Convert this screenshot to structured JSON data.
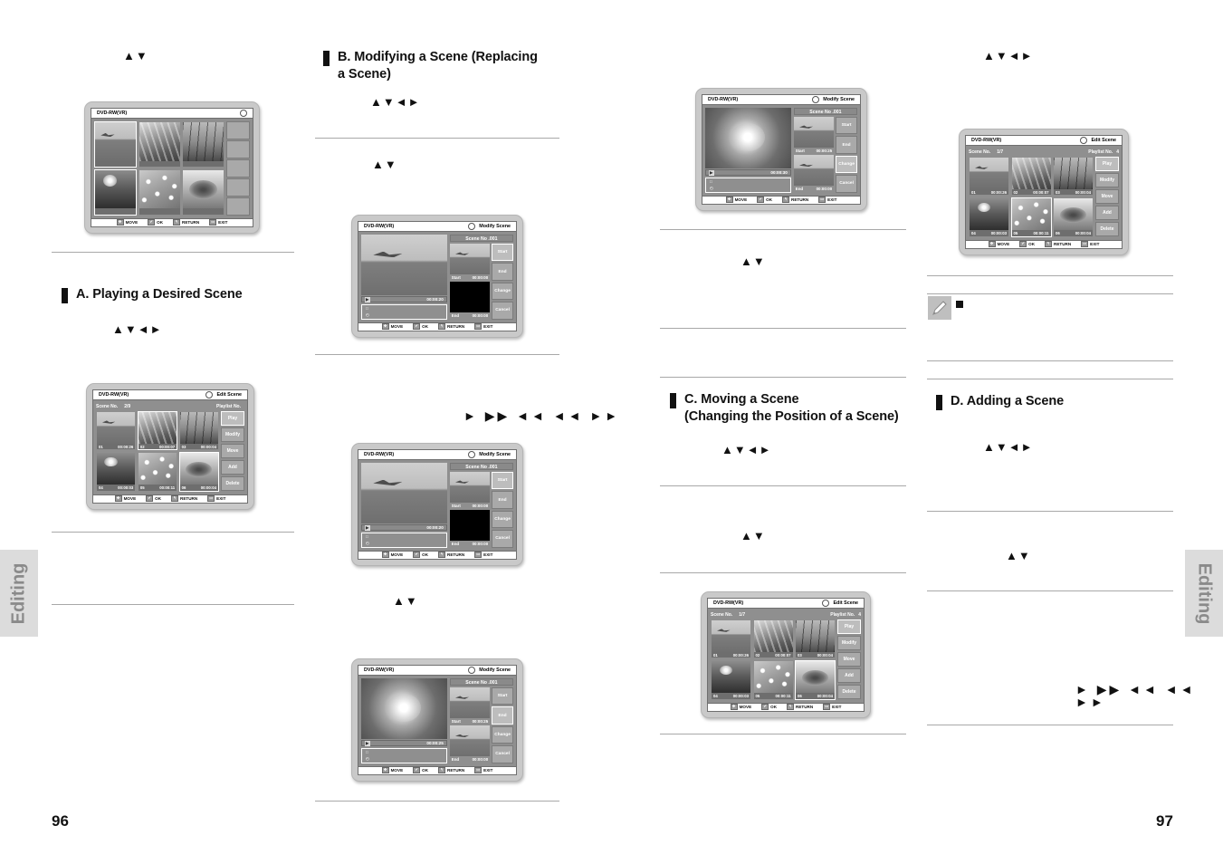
{
  "doc": {
    "left_page_number": "96",
    "right_page_number": "97",
    "left_tab_label": "Editing",
    "right_tab_label": "Editing"
  },
  "glyphs": {
    "ud": "▲▼",
    "udlr": "▲▼◄►",
    "transport": "► ▶▶ ◄◄ ◄◄ ►►",
    "note_bullet": "■"
  },
  "headings": {
    "a": "A. Playing a Desired Scene",
    "b": "B. Modifying a Scene (Replacing\na Scene)",
    "c": "C. Moving a Scene\n(Changing the Position of a Scene)",
    "d": "D. Adding a Scene"
  },
  "osd_common": {
    "disc_label": "DVD-RW(VR)",
    "footer": [
      {
        "key": "✥",
        "label": "MOVE"
      },
      {
        "key": "✔",
        "label": "OK"
      },
      {
        "key": "↰",
        "label": "RETURN"
      },
      {
        "key": "▭",
        "label": "EXIT"
      }
    ],
    "edit_buttons": [
      "Play",
      "Modify",
      "Move",
      "Add",
      "Delete"
    ],
    "modify_buttons": [
      "Start",
      "End",
      "Change",
      "Cancel"
    ],
    "scene_no_label": "Scene No.",
    "playlist_no_label": "Playlist No.",
    "start_label": "Start",
    "end_label": "End"
  },
  "screens": {
    "index_1": {
      "title": "",
      "cells": [
        {
          "id": "",
          "time": "",
          "photo": "ph-sky",
          "selected": true
        },
        {
          "id": "",
          "time": "",
          "photo": "ph-grass",
          "selected": false
        },
        {
          "id": "",
          "time": "",
          "photo": "ph-stems",
          "selected": false
        },
        {
          "id": "",
          "time": "",
          "photo": "ph-water",
          "selected": true
        },
        {
          "id": "",
          "time": "",
          "photo": "ph-speck",
          "selected": false
        },
        {
          "id": "",
          "time": "",
          "photo": "ph-dish",
          "selected": false
        }
      ],
      "buttons": [
        "",
        "",
        "",
        "",
        ""
      ],
      "show_info_row": false
    },
    "edit_scene_a": {
      "title": "Edit Scene",
      "scene_no_value": "2/9",
      "playlist_no_value": "",
      "cells": [
        {
          "id": "01",
          "time": "00:00:26",
          "photo": "ph-sky",
          "selected": false
        },
        {
          "id": "02",
          "time": "00:00:07",
          "photo": "ph-grass",
          "selected": true
        },
        {
          "id": "03",
          "time": "00:00:04",
          "photo": "ph-stems",
          "selected": false
        },
        {
          "id": "04",
          "time": "00:00:03",
          "photo": "ph-water",
          "selected": false
        },
        {
          "id": "05",
          "time": "00:00:11",
          "photo": "ph-speck",
          "selected": false
        },
        {
          "id": "06",
          "time": "00:00:04",
          "photo": "ph-dish",
          "selected": true
        }
      ],
      "highlight_button": "Play"
    },
    "edit_scene_d": {
      "title": "Edit Scene",
      "scene_no_value": "1/7",
      "playlist_no_value": "4",
      "cells": [
        {
          "id": "01",
          "time": "00:00:26",
          "photo": "ph-sky",
          "selected": false
        },
        {
          "id": "02",
          "time": "00:00:07",
          "photo": "ph-grass",
          "selected": false
        },
        {
          "id": "03",
          "time": "00:00:04",
          "photo": "ph-stems",
          "selected": false
        },
        {
          "id": "04",
          "time": "00:00:03",
          "photo": "ph-water",
          "selected": false
        },
        {
          "id": "05",
          "time": "00:00:11",
          "photo": "ph-speck",
          "selected": true
        },
        {
          "id": "06",
          "time": "00:00:04",
          "photo": "ph-dish",
          "selected": false
        }
      ],
      "highlight_button": "Play"
    },
    "edit_scene_c": {
      "title": "Edit Scene",
      "scene_no_value": "1/7",
      "playlist_no_value": "4",
      "cells": [
        {
          "id": "01",
          "time": "00:00:26",
          "photo": "ph-sky",
          "selected": false
        },
        {
          "id": "02",
          "time": "00:00:07",
          "photo": "ph-grass",
          "selected": false
        },
        {
          "id": "03",
          "time": "00:00:04",
          "photo": "ph-stems",
          "selected": false
        },
        {
          "id": "04",
          "time": "00:00:03",
          "photo": "ph-water",
          "selected": false
        },
        {
          "id": "05",
          "time": "00:00:11",
          "photo": "ph-speck",
          "selected": false
        },
        {
          "id": "06",
          "time": "00:00:04",
          "photo": "ph-dish",
          "selected": true
        }
      ],
      "highlight_button": "Play"
    },
    "modify_1": {
      "title": "Modify Scene",
      "scene_no": "Scene No .001",
      "elapsed": "00:00:20",
      "start_time": "00:00:00",
      "end_time": "00:00:00",
      "preview_photo": "ph-sky",
      "start_photo": "ph-sky",
      "end_photo": "black",
      "highlight_button": "Start"
    },
    "modify_2": {
      "title": "Modify Scene",
      "scene_no": "Scene No .001",
      "elapsed": "00:00:20",
      "start_time": "00:00:00",
      "end_time": "00:00:00",
      "preview_photo": "ph-sky",
      "start_photo": "ph-sky",
      "end_photo": "black",
      "highlight_button": "Start"
    },
    "modify_3": {
      "title": "Modify Scene",
      "scene_no": "Scene No .001",
      "elapsed": "00:00:25",
      "start_time": "00:00:25",
      "end_time": "00:00:00",
      "preview_photo": "ph-flower",
      "start_photo": "ph-sky",
      "end_photo": "ph-sky",
      "highlight_button": "End"
    },
    "modify_4": {
      "title": "Modify Scene",
      "scene_no": "Scene No .001",
      "elapsed": "00:00:30",
      "start_time": "00:00:25",
      "end_time": "00:00:00",
      "preview_photo": "ph-flower",
      "start_photo": "ph-sky",
      "end_photo": "ph-sky",
      "highlight_button": "Change"
    }
  }
}
